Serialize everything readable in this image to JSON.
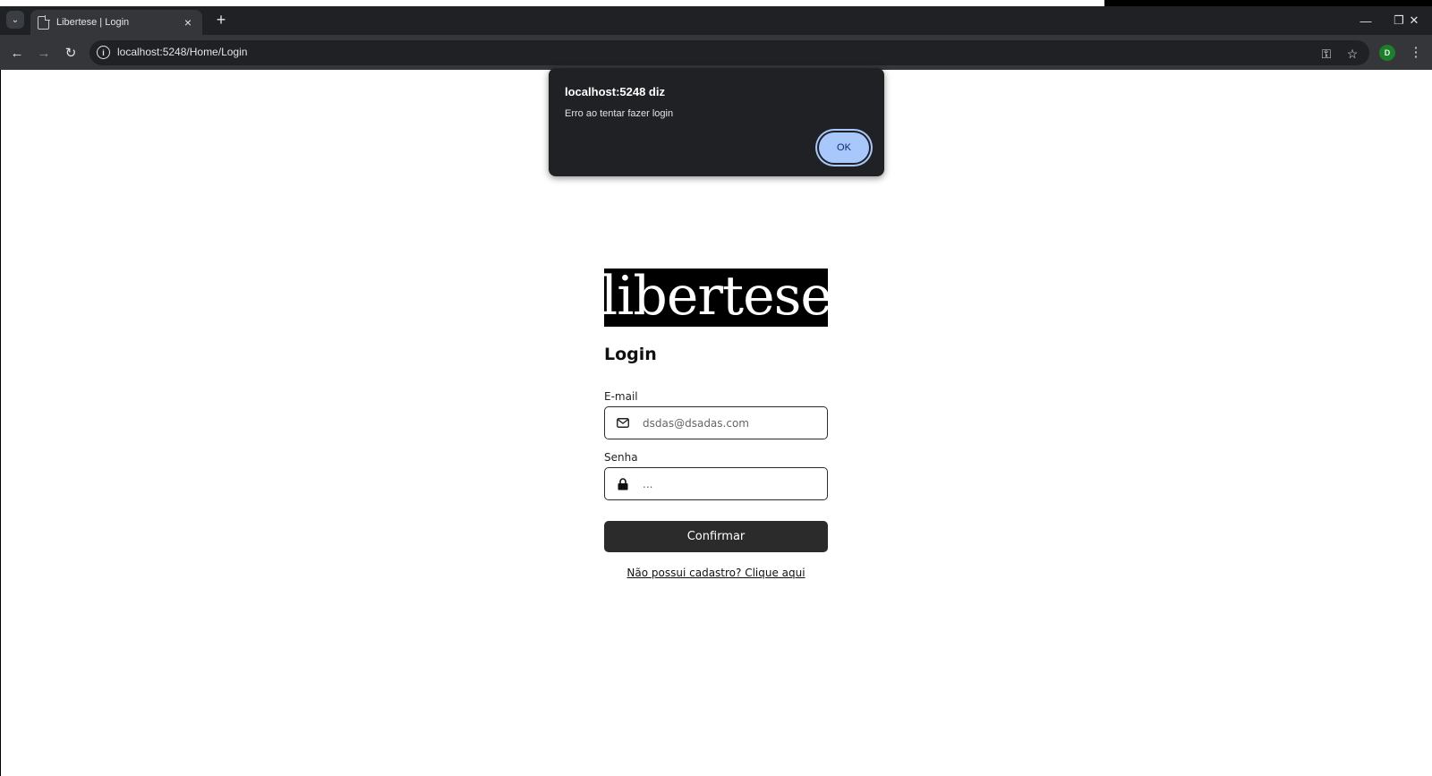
{
  "browser": {
    "tab": {
      "title": "Libertese | Login",
      "close_icon": "×"
    },
    "new_tab_icon": "+",
    "tab_list_icon": "⌄",
    "window_controls": {
      "minimize": "—",
      "restore": "❐",
      "close": "✕"
    },
    "nav": {
      "back": "←",
      "forward": "→",
      "reload": "↻"
    },
    "address": {
      "url": "localhost:5248/Home/Login",
      "info_icon": "i"
    },
    "toolbar_icons": {
      "password": "⚿",
      "bookmark": "☆",
      "menu": "⋮"
    },
    "profile_initial": "D"
  },
  "dialog": {
    "title": "localhost:5248 diz",
    "message": "Erro ao tentar fazer login",
    "ok_label": "OK"
  },
  "login": {
    "logo_text": "libertese",
    "title": "Login",
    "email_label": "E-mail",
    "email_value": "dsdas@dsadas.com",
    "password_label": "Senha",
    "password_value": "...",
    "confirm_label": "Confirmar",
    "signup_link": "Não possui cadastro? Clique aqui"
  },
  "colors": {
    "browser_frame": "#1f2125",
    "toolbar": "#35363a",
    "dialog_ok": "#a8c7fa",
    "button_dark": "#2b2b2b",
    "profile": "#1b7f2c"
  }
}
